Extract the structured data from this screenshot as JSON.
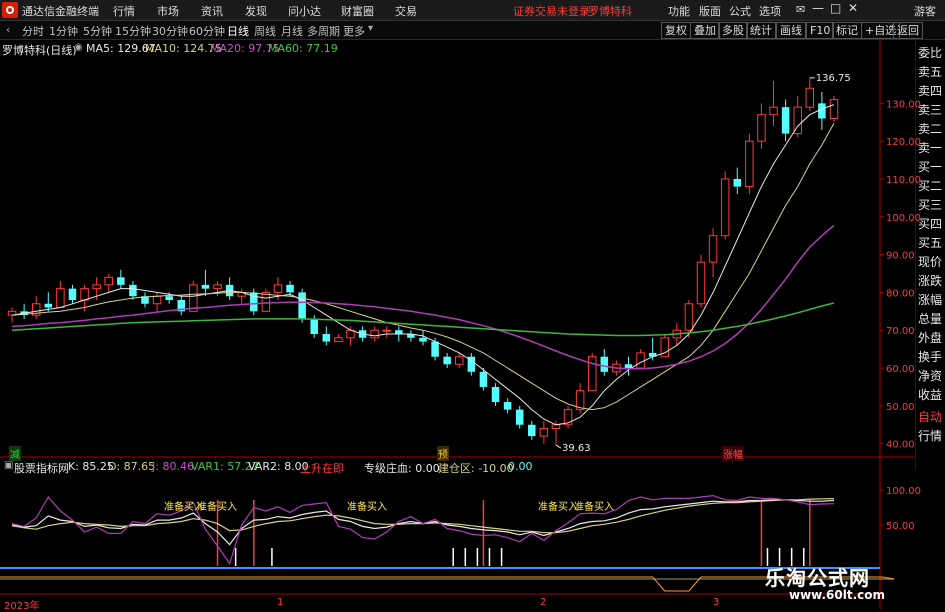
{
  "window": {
    "title": "通达信金融终端",
    "menus": [
      "行情",
      "市场",
      "资讯",
      "发现",
      "问小达",
      "财富圈",
      "交易"
    ],
    "alert": "证券交易未登录",
    "stock_name_top": "罗博特科",
    "right_menus": [
      "功能",
      "版面",
      "公式",
      "选项"
    ],
    "guest": "游客"
  },
  "periods": [
    "分时",
    "1分钟",
    "5分钟",
    "15分钟",
    "30分钟",
    "60分钟",
    "日线",
    "周线",
    "月线",
    "多周期",
    "更多"
  ],
  "active_period": "日线",
  "toolbar_right": [
    "复权",
    "叠加",
    "多股",
    "统计",
    "画线",
    "F10",
    "标记",
    "+自选",
    "返回"
  ],
  "legend": {
    "stock": "罗博特科(日线)",
    "ma5": "MA5: 129.67",
    "ma10": "MA10: 124.75",
    "ma20": "MA20: 97.75",
    "ma60": "MA60: 77.19"
  },
  "side_panel": [
    "委比",
    "卖五",
    "卖四",
    "卖三",
    "卖二",
    "卖一",
    "买一",
    "买二",
    "买三",
    "买四",
    "买五",
    "现价",
    "涨跌",
    "涨幅",
    "总量",
    "外盘",
    "换手",
    "净资",
    "收益",
    "自动",
    "行情"
  ],
  "colors": {
    "up": "#ff3a3a",
    "down": "#54ffff",
    "ma5": "#e8e8e8",
    "ma10": "#d8d28a",
    "ma20": "#b03cb8",
    "ma60": "#3cb83c",
    "axis": "#b00000"
  },
  "markers": {
    "bottom_left": "减",
    "mid": "预",
    "right": "涨幅"
  },
  "indicator_legend": {
    "name": "股票指标网",
    "k": "K: 85.25",
    "d": "D: 87.65",
    "j": "J: 80.46",
    "var1": "VAR1: 57.27",
    "var2": "VAR2: 8.00",
    "sxzy": "上升在即",
    "zjzc": "专级庄血: 0.00",
    "jcq": "建仓区: -10.00",
    "tail": "0.00"
  },
  "signals": [
    "准备买入",
    "准备买入",
    "准备买入",
    "准备买入",
    "准备买入"
  ],
  "x_labels": [
    "2023年",
    "1",
    "2",
    "3"
  ],
  "watermark": {
    "line1": "乐淘公式网",
    "line2": "www.60lt.com"
  },
  "chart_data": [
    {
      "type": "candlestick",
      "ylim": [
        37,
        142
      ],
      "yticks": [
        "130.00",
        "120.00",
        "110.00",
        "100.00",
        "90.00",
        "80.00",
        "70.00",
        "60.00",
        "50.00",
        "40.00"
      ],
      "ytick_values": [
        130,
        120,
        110,
        100,
        90,
        80,
        70,
        60,
        50,
        40
      ],
      "annotations": [
        {
          "text": "136.75",
          "index": 66,
          "value": 136.75
        },
        {
          "text": "39.63",
          "index": 45,
          "value": 39.63
        }
      ],
      "ohlc": [
        [
          74,
          76,
          72,
          75
        ],
        [
          75,
          77,
          73,
          74
        ],
        [
          74,
          79,
          73,
          77
        ],
        [
          77,
          80,
          75,
          76
        ],
        [
          76,
          83,
          76,
          81
        ],
        [
          81,
          82,
          77,
          78
        ],
        [
          78,
          82,
          75,
          81
        ],
        [
          81,
          84,
          78,
          82
        ],
        [
          82,
          85,
          80,
          84
        ],
        [
          84,
          86,
          81,
          82
        ],
        [
          82,
          83,
          78,
          79
        ],
        [
          79,
          80,
          76,
          77
        ],
        [
          77,
          80,
          75,
          79
        ],
        [
          79,
          80,
          77,
          78
        ],
        [
          78,
          79,
          74,
          75
        ],
        [
          75,
          83,
          75,
          82
        ],
        [
          82,
          86,
          79,
          81
        ],
        [
          81,
          83,
          79,
          82
        ],
        [
          82,
          84,
          78,
          79
        ],
        [
          79,
          81,
          77,
          80
        ],
        [
          80,
          81,
          74,
          75
        ],
        [
          75,
          81,
          75,
          80
        ],
        [
          80,
          84,
          78,
          82
        ],
        [
          82,
          83,
          79,
          80
        ],
        [
          80,
          81,
          72,
          73
        ],
        [
          73,
          74,
          68,
          69
        ],
        [
          69,
          71,
          66,
          67
        ],
        [
          67,
          69,
          67,
          68
        ],
        [
          68,
          71,
          66,
          70
        ],
        [
          70,
          71,
          67,
          68
        ],
        [
          68,
          71,
          67,
          70
        ],
        [
          70,
          71,
          68,
          70
        ],
        [
          70,
          71,
          67,
          69
        ],
        [
          69,
          70,
          67,
          68
        ],
        [
          68,
          70,
          66,
          67
        ],
        [
          67,
          68,
          62,
          63
        ],
        [
          63,
          64,
          60,
          61
        ],
        [
          61,
          64,
          60,
          63
        ],
        [
          63,
          64,
          58,
          59
        ],
        [
          59,
          60,
          54,
          55
        ],
        [
          55,
          56,
          50,
          51
        ],
        [
          51,
          52,
          48,
          49
        ],
        [
          49,
          50,
          44,
          45
        ],
        [
          45,
          46,
          41,
          42
        ],
        [
          42,
          46,
          40,
          44
        ],
        [
          44,
          46,
          39.63,
          45
        ],
        [
          45,
          50,
          44,
          49
        ],
        [
          49,
          56,
          48,
          54
        ],
        [
          54,
          64,
          54,
          63
        ],
        [
          63,
          65,
          58,
          59
        ],
        [
          59,
          62,
          58,
          61
        ],
        [
          61,
          63,
          58,
          60
        ],
        [
          60,
          65,
          60,
          64
        ],
        [
          64,
          68,
          62,
          63
        ],
        [
          63,
          69,
          63,
          68
        ],
        [
          68,
          72,
          66,
          70
        ],
        [
          70,
          78,
          68,
          77
        ],
        [
          77,
          90,
          76,
          88
        ],
        [
          88,
          97,
          84,
          95
        ],
        [
          95,
          112,
          94,
          110
        ],
        [
          110,
          113,
          106,
          108
        ],
        [
          108,
          122,
          106,
          120
        ],
        [
          120,
          130,
          118,
          127
        ],
        [
          127,
          136,
          124,
          129
        ],
        [
          129,
          131,
          120,
          122
        ],
        [
          122,
          132,
          121,
          129
        ],
        [
          129,
          136.75,
          128,
          134
        ],
        [
          130,
          133,
          123,
          126
        ],
        [
          126,
          132,
          125,
          131
        ]
      ],
      "series": [
        {
          "name": "MA5",
          "values": [
            74,
            74.5,
            75,
            75.5,
            76,
            77,
            78,
            79,
            80,
            81,
            81,
            80.5,
            80,
            79.5,
            79,
            79,
            79.5,
            80,
            80.5,
            80,
            79,
            78.5,
            79,
            79.5,
            78,
            76,
            74,
            72,
            70,
            69,
            68.5,
            69,
            69,
            69,
            68.5,
            67,
            65.5,
            64,
            62,
            59.5,
            57,
            54.5,
            52,
            49,
            46.5,
            45,
            45.5,
            47,
            50,
            54,
            57,
            59.5,
            61.5,
            63,
            64,
            66,
            69,
            74,
            80,
            87,
            94,
            101,
            108,
            114,
            119,
            124,
            127,
            128.5,
            129.67
          ]
        },
        {
          "name": "MA10",
          "values": [
            74,
            74.2,
            74.5,
            74.8,
            75,
            75.5,
            76,
            76.8,
            77.5,
            78,
            78.5,
            78.8,
            79,
            79.2,
            79.3,
            79.5,
            79.6,
            79.8,
            80,
            80,
            79.8,
            79.5,
            79.2,
            79,
            78.5,
            77.8,
            77,
            76,
            75,
            74,
            73,
            72,
            71.3,
            70.6,
            70,
            69.2,
            68.2,
            67,
            65.5,
            64,
            62,
            60,
            58,
            56,
            54,
            52,
            50.5,
            49.5,
            49,
            49.5,
            51,
            53,
            55,
            57,
            59,
            61,
            63,
            66,
            70,
            75,
            80,
            85,
            91,
            97,
            103,
            108,
            114,
            119,
            124.75
          ]
        },
        {
          "name": "MA20",
          "values": [
            71,
            71.2,
            71.5,
            71.8,
            72,
            72.3,
            72.6,
            73,
            73.3,
            73.7,
            74,
            74.4,
            74.8,
            75.2,
            75.5,
            75.8,
            76,
            76.3,
            76.6,
            76.8,
            77,
            77.2,
            77.3,
            77.4,
            77.4,
            77.3,
            77.2,
            77,
            76.8,
            76.5,
            76.2,
            75.8,
            75.4,
            75,
            74.5,
            74,
            73.4,
            72.8,
            72,
            71.2,
            70.3,
            69.3,
            68.2,
            67,
            65.8,
            64.5,
            63.3,
            62.2,
            61.2,
            60.5,
            60,
            59.8,
            59.8,
            60,
            60.4,
            61,
            61.8,
            63,
            64.5,
            66.5,
            69,
            72,
            75.5,
            79.5,
            83.5,
            88,
            92,
            95,
            97.75
          ]
        },
        {
          "name": "MA60",
          "values": [
            70,
            70.2,
            70.4,
            70.6,
            70.8,
            71,
            71.2,
            71.4,
            71.6,
            71.8,
            72,
            72.1,
            72.2,
            72.3,
            72.4,
            72.5,
            72.6,
            72.7,
            72.8,
            72.9,
            73,
            73,
            73,
            73,
            73,
            72.9,
            72.8,
            72.7,
            72.6,
            72.4,
            72.2,
            72,
            71.8,
            71.6,
            71.4,
            71.2,
            71,
            70.8,
            70.6,
            70.4,
            70.2,
            70,
            69.8,
            69.6,
            69.4,
            69.2,
            69,
            68.9,
            68.8,
            68.7,
            68.6,
            68.6,
            68.6,
            68.7,
            68.8,
            69,
            69.3,
            69.6,
            70,
            70.5,
            71,
            71.6,
            72.3,
            73,
            73.8,
            74.6,
            75.5,
            76.4,
            77.19
          ]
        }
      ]
    },
    {
      "type": "line",
      "ylim": [
        -10,
        120
      ],
      "yticks": [
        "100.00",
        "50.00"
      ],
      "ytick_values": [
        100,
        50
      ],
      "series": [
        {
          "name": "K",
          "values": [
            50,
            47,
            49,
            63,
            57,
            55,
            48,
            50,
            46,
            45,
            51,
            50,
            57,
            57,
            60,
            67,
            52,
            40,
            22,
            45,
            57,
            58,
            62,
            60,
            65,
            68,
            70,
            58,
            55,
            48,
            45,
            47,
            52,
            55,
            52,
            55,
            50,
            48,
            45,
            43,
            42,
            40,
            36,
            40,
            35,
            40,
            45,
            52,
            55,
            56,
            60,
            67,
            72,
            73,
            76,
            78,
            80,
            82,
            84,
            83,
            83,
            85,
            85.25,
            86,
            86,
            85,
            84,
            84,
            85
          ]
        },
        {
          "name": "D",
          "values": [
            49,
            46,
            44,
            49,
            52,
            54,
            52,
            51,
            50,
            48,
            49,
            49,
            52,
            53,
            55,
            59,
            57,
            52,
            42,
            43,
            48,
            52,
            55,
            56,
            59,
            62,
            64,
            63,
            60,
            56,
            52,
            51,
            51,
            52,
            52,
            53,
            52,
            51,
            49,
            47,
            45,
            43,
            41,
            41,
            39,
            39,
            41,
            45,
            49,
            51,
            54,
            58,
            63,
            67,
            71,
            74,
            77,
            79,
            81,
            82,
            82,
            83,
            84,
            85,
            86,
            86,
            87,
            87.5,
            87.65
          ]
        },
        {
          "name": "J",
          "values": [
            52,
            48,
            60,
            90,
            70,
            57,
            40,
            47,
            38,
            38,
            55,
            52,
            66,
            64,
            70,
            82,
            44,
            20,
            -5,
            50,
            75,
            70,
            76,
            68,
            78,
            80,
            82,
            48,
            44,
            32,
            30,
            40,
            55,
            62,
            52,
            58,
            45,
            42,
            37,
            35,
            36,
            32,
            26,
            38,
            28,
            42,
            53,
            66,
            67,
            66,
            72,
            85,
            90,
            86,
            88,
            88,
            88,
            90,
            92,
            86,
            85,
            90,
            88,
            88,
            86,
            83,
            79,
            80,
            80.46
          ]
        }
      ]
    }
  ]
}
